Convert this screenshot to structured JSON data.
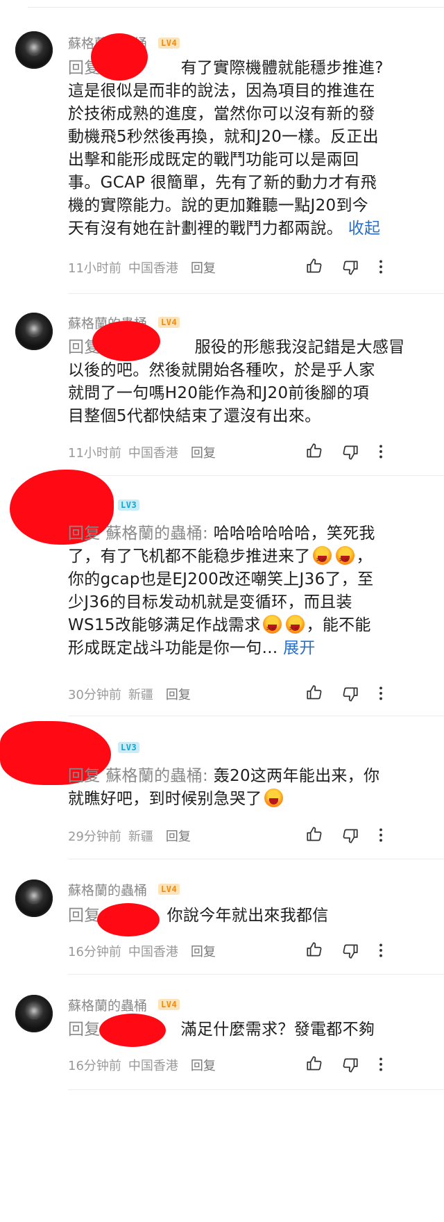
{
  "comments": [
    {
      "username": "蘇格蘭的蟲桶",
      "level": "LV4",
      "reply_prefix": "回复",
      "lines": [
        "有了實際機體就能穩步推進?",
        "這是很似是而非的說法，因為項目的推進在",
        "於技術成熟的進度，當然你可以沒有新的發",
        "動機飛5秒然後再換，就和J20一樣。反正出",
        "出擊和能形成既定的戰鬥功能可以是兩回",
        "事。GCAP 很簡單，先有了新的動力才有飛",
        "機的實際能力。說的更加難聽一點J20到今",
        "天有沒有她在計劃裡的戰鬥力都兩說。"
      ],
      "collapse": "收起",
      "time": "11小时前",
      "location": "中国香港",
      "reply": "回复"
    },
    {
      "username": "蘇格蘭的蟲桶",
      "level": "LV4",
      "reply_prefix": "回复",
      "lines": [
        "服役的形態我沒記錯是大感冒",
        "以後的吧。然後就開始各種吹，於是乎人家",
        "就問了一句嗎H20能作為和J20前後腳的項",
        "目整個5代都快結束了還沒有出來。"
      ],
      "time": "11小时前",
      "location": "中国香港",
      "reply": "回复"
    },
    {
      "level": "LV3",
      "reply_prefix": "回复",
      "reply_target": "蘇格蘭的蟲桶:",
      "lines": [
        "哈哈哈哈哈哈，笑死我",
        "了，有了飞机都不能稳步推进来了",
        "你的gcap也是EJ200改还嘲笑上J36了，至",
        "少J36的目标发动机就是变循环，而且装",
        "WS15改能够满足作战需求",
        "形成既定战斗功能是你一句..."
      ],
      "tail_after_emoji": "，能不能",
      "expand": "展开",
      "time": "30分钟前",
      "location": "新疆",
      "reply": "回复"
    },
    {
      "level": "LV3",
      "reply_prefix": "回复",
      "reply_target": "蘇格蘭的蟲桶:",
      "lines": [
        "轰20这两年能出来，你",
        "就瞧好吧，到时候别急哭了"
      ],
      "time": "29分钟前",
      "location": "新疆",
      "reply": "回复"
    },
    {
      "username": "蘇格蘭的蟲桶",
      "level": "LV4",
      "reply_prefix": "回复",
      "lines": [
        "你說今年就出來我都信"
      ],
      "time": "16分钟前",
      "location": "中国香港",
      "reply": "回复"
    },
    {
      "username": "蘇格蘭的蟲桶",
      "level": "LV4",
      "reply_prefix": "回复",
      "lines": [
        "滿足什麼需求？發電都不夠"
      ],
      "time": "16分钟前",
      "location": "中国香港",
      "reply": "回复"
    }
  ],
  "icons": {
    "like": "thumbs-up-icon",
    "dislike": "thumbs-down-icon",
    "more": "more-vertical-icon",
    "emoji": "laughing-emoji-icon"
  },
  "colors": {
    "level4_bg": "#fde3b8",
    "level4_fg": "#f08a10",
    "level3_bg": "#c9ecf6",
    "level3_fg": "#1aa3cc",
    "link": "#2a6fc9",
    "redaction": "#ff0a14"
  }
}
